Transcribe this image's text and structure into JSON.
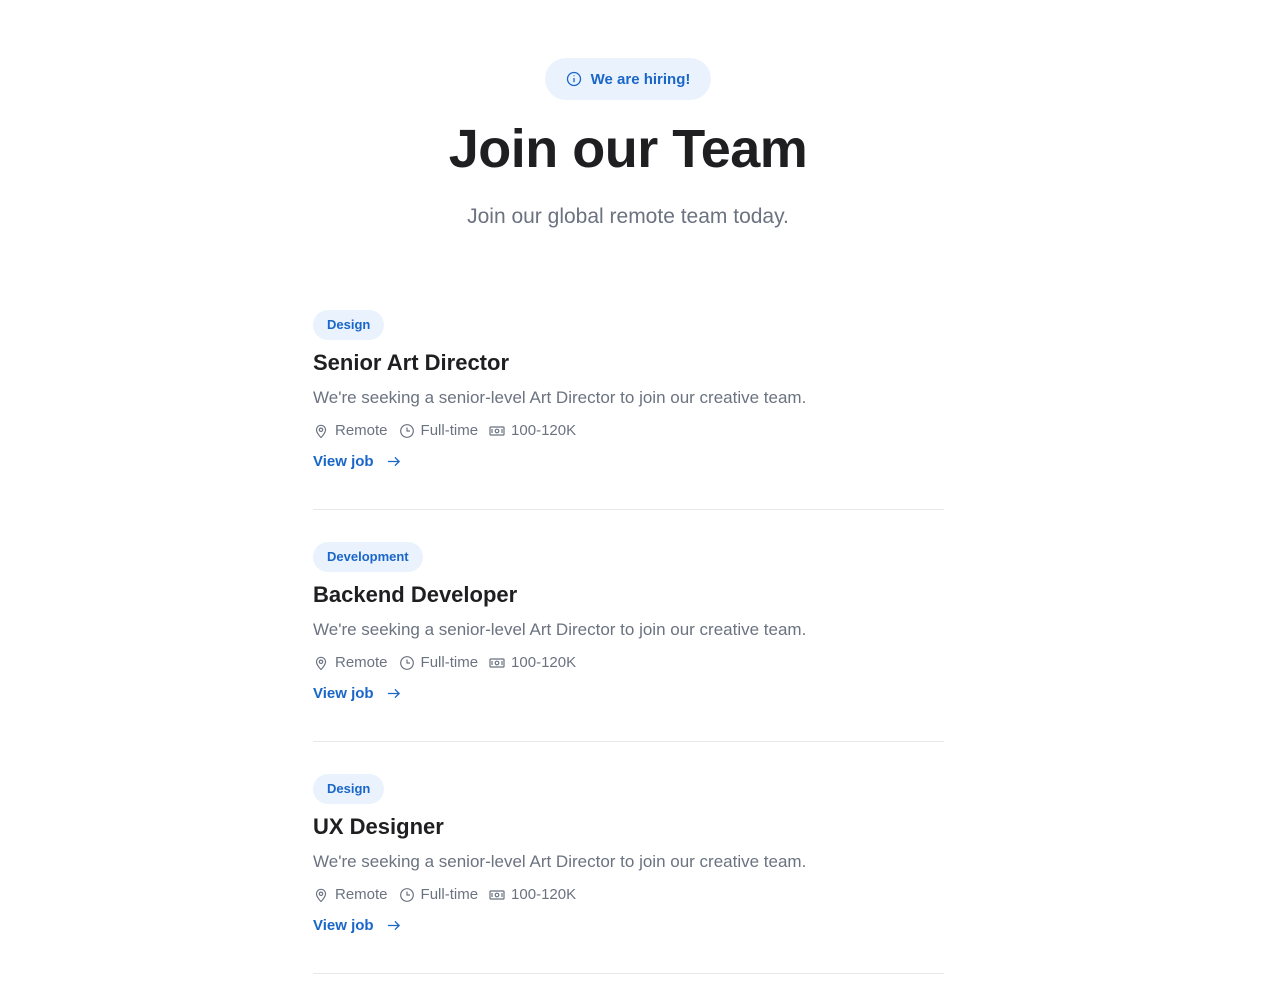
{
  "header": {
    "badge_icon": "info-circle-icon",
    "badge_label": "We are hiring!",
    "title": "Join our Team",
    "subtitle": "Join our global remote team today."
  },
  "colors": {
    "accent": "#1b66c9",
    "badge_bg": "#eaf3fd",
    "heading": "#1f1f22",
    "muted": "#6b7280",
    "divider": "#e7e8ea"
  },
  "jobs": [
    {
      "category": "Design",
      "title": "Senior Art Director",
      "description": "We're seeking a senior-level Art Director to join our creative team.",
      "location": "Remote",
      "type": "Full-time",
      "salary": "100-120K",
      "link_label": "View job"
    },
    {
      "category": "Development",
      "title": "Backend Developer",
      "description": "We're seeking a senior-level Art Director to join our creative team.",
      "location": "Remote",
      "type": "Full-time",
      "salary": "100-120K",
      "link_label": "View job"
    },
    {
      "category": "Design",
      "title": "UX Designer",
      "description": "We're seeking a senior-level Art Director to join our creative team.",
      "location": "Remote",
      "type": "Full-time",
      "salary": "100-120K",
      "link_label": "View job"
    }
  ]
}
